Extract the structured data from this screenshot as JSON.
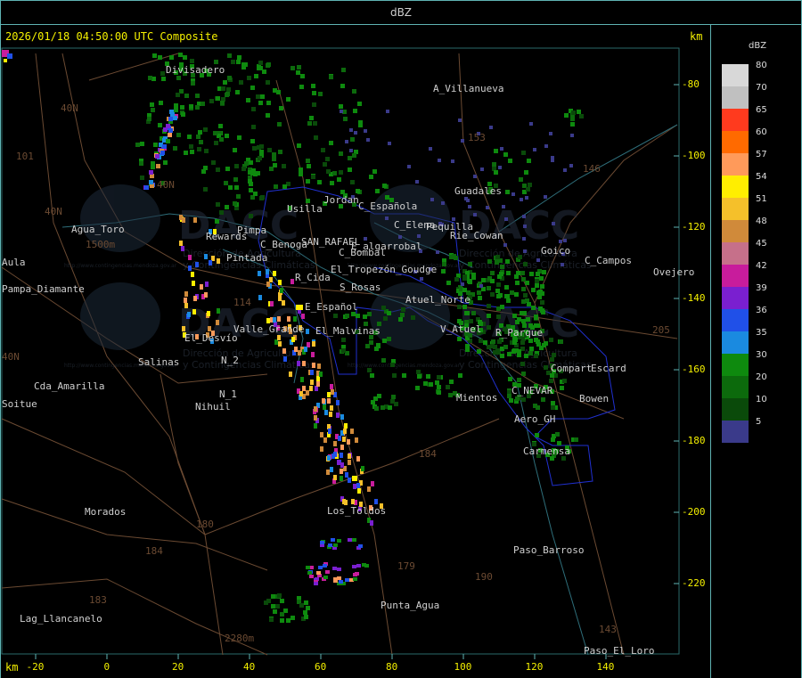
{
  "window_title": "dBZ",
  "header": {
    "timestamp": "2026/01/18 04:50:00 UTC Composite",
    "km_top": "km",
    "km_bottom": "km"
  },
  "axes": {
    "x_ticks": [
      "-20",
      "0",
      "20",
      "40",
      "60",
      "80",
      "100",
      "120",
      "140"
    ],
    "y_ticks": [
      "-80",
      "-100",
      "-120",
      "-140",
      "-160",
      "-180",
      "-200",
      "-220"
    ]
  },
  "legend": {
    "unit": "dBZ",
    "entries": [
      {
        "value": "80",
        "color": "#d8d8d8"
      },
      {
        "value": "70",
        "color": "#c0c0c0"
      },
      {
        "value": "65",
        "color": "#ff3a1e"
      },
      {
        "value": "60",
        "color": "#ff6a00"
      },
      {
        "value": "57",
        "color": "#ff9a5a"
      },
      {
        "value": "54",
        "color": "#ffee00"
      },
      {
        "value": "51",
        "color": "#f5c02a"
      },
      {
        "value": "48",
        "color": "#d08a3a"
      },
      {
        "value": "45",
        "color": "#c6708a"
      },
      {
        "value": "42",
        "color": "#c81c9c"
      },
      {
        "value": "39",
        "color": "#7a1fd0"
      },
      {
        "value": "36",
        "color": "#2050e8"
      },
      {
        "value": "35",
        "color": "#1a8ae0"
      },
      {
        "value": "30",
        "color": "#0e8a0e"
      },
      {
        "value": "20",
        "color": "#0c6a0c"
      },
      {
        "value": "10",
        "color": "#0a4a0a"
      },
      {
        "value": "5",
        "color": "#3a3a8a"
      }
    ]
  },
  "watermark": {
    "brand": "DACC",
    "line1": "Dirección de Agricultura",
    "line2": "y Contingencias Climáticas",
    "url": "http://www.contingencias.mendoza.gov.ar"
  },
  "places": [
    {
      "name": "Divisadero",
      "bright": true
    },
    {
      "name": "A_Villanueva",
      "bright": true
    },
    {
      "name": "Guadales",
      "bright": true
    },
    {
      "name": "Agua_Toro",
      "bright": true
    },
    {
      "name": "Aula",
      "bright": true
    },
    {
      "name": "Pampa_Diamante",
      "bright": true
    },
    {
      "name": "Usilla",
      "bright": true
    },
    {
      "name": "Jordan",
      "bright": true
    },
    {
      "name": "C_Española",
      "bright": true
    },
    {
      "name": "C_Elena",
      "bright": true
    },
    {
      "name": "Pequilla",
      "bright": true
    },
    {
      "name": "Rie_Cowan",
      "bright": true
    },
    {
      "name": "Goico",
      "bright": true
    },
    {
      "name": "C_Campos",
      "bright": true
    },
    {
      "name": "Ovejero",
      "bright": true
    },
    {
      "name": "Pimpa",
      "bright": true
    },
    {
      "name": "Rewards",
      "bright": true
    },
    {
      "name": "Pintada",
      "bright": true
    },
    {
      "name": "C_Benoga",
      "bright": true
    },
    {
      "name": "SAN_RAFAEL",
      "bright": true
    },
    {
      "name": "E_algarrobal",
      "bright": true
    },
    {
      "name": "C_Bombal",
      "bright": true
    },
    {
      "name": "El_Tropezón_Goudge",
      "bright": true
    },
    {
      "name": "R_Cida",
      "bright": true
    },
    {
      "name": "S_Rosas",
      "bright": true
    },
    {
      "name": "Atuel_Norte",
      "bright": true
    },
    {
      "name": "E_Español",
      "bright": true
    },
    {
      "name": "Valle_Grande",
      "bright": true
    },
    {
      "name": "El_Malvinas",
      "bright": true
    },
    {
      "name": "V_Atuel",
      "bright": true
    },
    {
      "name": "R_Parque",
      "bright": true
    },
    {
      "name": "El_Desvío",
      "bright": true
    },
    {
      "name": "Salinas",
      "bright": true
    },
    {
      "name": "N_2",
      "bright": true
    },
    {
      "name": "Compart",
      "bright": true
    },
    {
      "name": "Escard",
      "bright": true
    },
    {
      "name": "Cda_Amarilla",
      "bright": true
    },
    {
      "name": "N_1",
      "bright": true
    },
    {
      "name": "Nihuil",
      "bright": true
    },
    {
      "name": "Soitue",
      "bright": true
    },
    {
      "name": "C_NEVAR",
      "bright": true
    },
    {
      "name": "Bowen",
      "bright": true
    },
    {
      "name": "Mientos",
      "bright": true
    },
    {
      "name": "Aero_GH",
      "bright": true
    },
    {
      "name": "Carmensa",
      "bright": true
    },
    {
      "name": "Morados",
      "bright": true
    },
    {
      "name": "Los_Toldos",
      "bright": true
    },
    {
      "name": "Paso_Barroso",
      "bright": true
    },
    {
      "name": "Lag_Llancanelo",
      "bright": true
    },
    {
      "name": "Punta_Agua",
      "bright": true
    },
    {
      "name": "Paso_El_Loro",
      "bright": true
    }
  ],
  "route_numbers": [
    "153",
    "146",
    "143",
    "101",
    "40N",
    "40N",
    "184",
    "179",
    "190",
    "183",
    "184",
    "180",
    "114",
    "2280m",
    "1500m",
    "205",
    "40N",
    "40N"
  ]
}
